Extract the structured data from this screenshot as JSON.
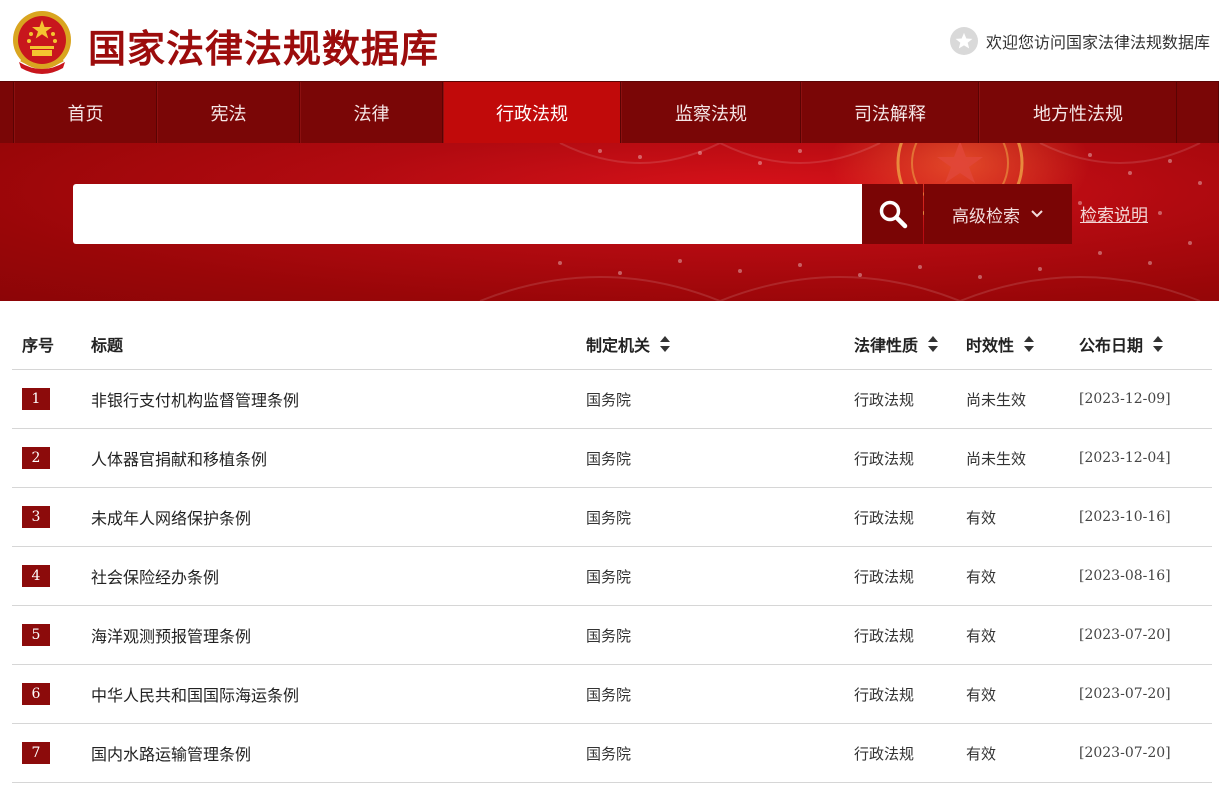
{
  "header": {
    "site_title": "国家法律法规数据库",
    "welcome": "欢迎您访问国家法律法规数据库"
  },
  "nav": {
    "items": [
      {
        "label": "首页"
      },
      {
        "label": "宪法"
      },
      {
        "label": "法律"
      },
      {
        "label": "行政法规",
        "active": true
      },
      {
        "label": "监察法规"
      },
      {
        "label": "司法解释"
      },
      {
        "label": "地方性法规"
      }
    ]
  },
  "search": {
    "value": "",
    "advanced_label": "高级检索",
    "help_label": "检索说明"
  },
  "table": {
    "headers": {
      "no": "序号",
      "title": "标题",
      "org": "制定机关",
      "type": "法律性质",
      "validity": "时效性",
      "date": "公布日期"
    },
    "rows": [
      {
        "no": "1",
        "title": "非银行支付机构监督管理条例",
        "org": "国务院",
        "type": "行政法规",
        "validity": "尚未生效",
        "date": "[2023-12-09]"
      },
      {
        "no": "2",
        "title": "人体器官捐献和移植条例",
        "org": "国务院",
        "type": "行政法规",
        "validity": "尚未生效",
        "date": "[2023-12-04]"
      },
      {
        "no": "3",
        "title": "未成年人网络保护条例",
        "org": "国务院",
        "type": "行政法规",
        "validity": "有效",
        "date": "[2023-10-16]"
      },
      {
        "no": "4",
        "title": "社会保险经办条例",
        "org": "国务院",
        "type": "行政法规",
        "validity": "有效",
        "date": "[2023-08-16]"
      },
      {
        "no": "5",
        "title": "海洋观测预报管理条例",
        "org": "国务院",
        "type": "行政法规",
        "validity": "有效",
        "date": "[2023-07-20]"
      },
      {
        "no": "6",
        "title": "中华人民共和国国际海运条例",
        "org": "国务院",
        "type": "行政法规",
        "validity": "有效",
        "date": "[2023-07-20]"
      },
      {
        "no": "7",
        "title": "国内水路运输管理条例",
        "org": "国务院",
        "type": "行政法规",
        "validity": "有效",
        "date": "[2023-07-20]"
      }
    ]
  },
  "colors": {
    "brand_red": "#9c0c0c",
    "nav_dark": "#7a0606",
    "nav_active": "#c10a0a",
    "badge": "#8c0b0b"
  }
}
